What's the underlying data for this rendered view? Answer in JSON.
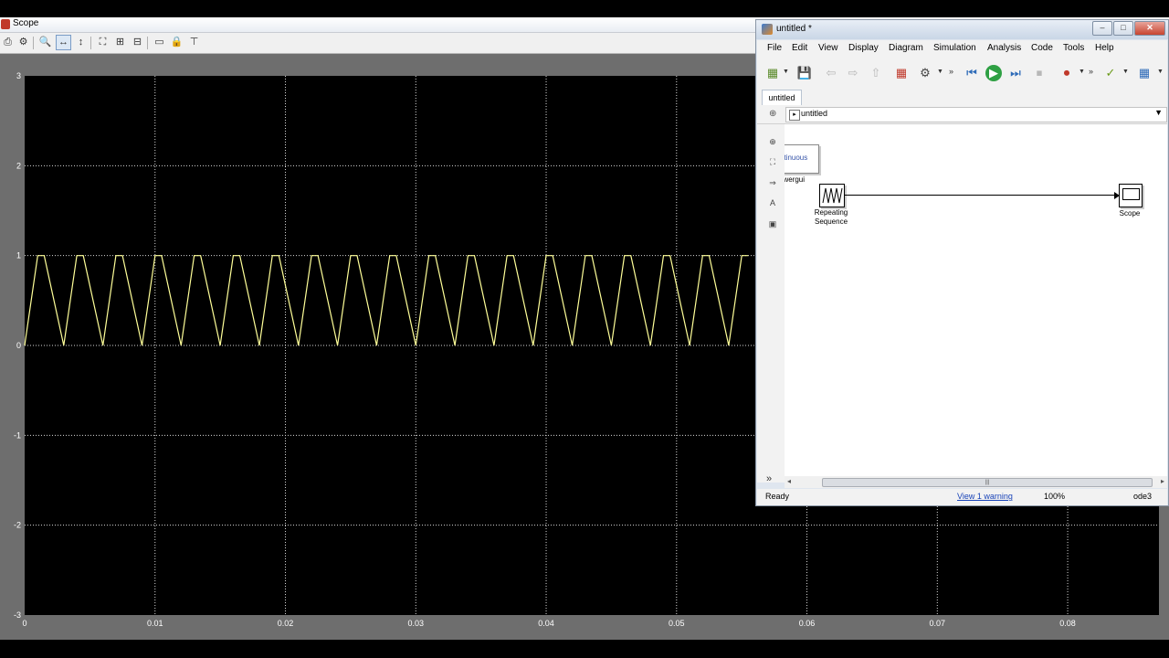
{
  "scope": {
    "title": "Scope",
    "toolbar_icons": [
      "print-icon",
      "parameters-icon",
      "zoom-icon",
      "zoom-x-icon",
      "zoom-y-icon",
      "autoscale-icon",
      "save-axes-icon",
      "restore-axes-icon",
      "floating-scope-icon",
      "lock-icon",
      "signal-selection-icon"
    ]
  },
  "chart_data": {
    "type": "line",
    "series": [
      {
        "x": [
          0,
          0.001,
          0.0015,
          0.003,
          0.004,
          0.0045,
          0.006,
          0.007,
          0.0075,
          0.009,
          0.01,
          0.0105,
          0.012,
          0.013,
          0.0135,
          0.015,
          0.016,
          0.0165,
          0.018,
          0.019,
          0.0195,
          0.021,
          0.022,
          0.0225,
          0.024,
          0.025,
          0.0255,
          0.027,
          0.028,
          0.0285,
          0.03,
          0.031,
          0.0315,
          0.033,
          0.034,
          0.0345,
          0.036,
          0.037,
          0.0375,
          0.039,
          0.04,
          0.0405,
          0.042,
          0.043,
          0.0435,
          0.045,
          0.046,
          0.0465,
          0.048,
          0.049,
          0.0495,
          0.051,
          0.052,
          0.0525,
          0.054,
          0.055,
          0.0555
        ],
        "y": [
          0,
          1,
          1,
          0,
          1,
          1,
          0,
          1,
          1,
          0,
          1,
          1,
          0,
          1,
          1,
          0,
          1,
          1,
          0,
          1,
          1,
          0,
          1,
          1,
          0,
          1,
          1,
          0,
          1,
          1,
          0,
          1,
          1,
          0,
          1,
          1,
          0,
          1,
          1,
          0,
          1,
          1,
          0,
          1,
          1,
          0,
          1,
          1,
          0,
          1,
          1,
          0,
          1,
          1,
          0,
          1,
          1
        ]
      }
    ],
    "xlim": [
      0,
      0.087
    ],
    "ylim": [
      -3,
      3
    ],
    "xticks": [
      "0",
      "0.01",
      "0.02",
      "0.03",
      "0.04",
      "0.05",
      "0.06",
      "0.07",
      "0.08"
    ],
    "yticks": [
      "3",
      "2",
      "1",
      "0",
      "-1",
      "-2",
      "-3"
    ],
    "grid": true,
    "line_color": "#ffff99",
    "background": "#000000"
  },
  "sim": {
    "title": "untitled *",
    "window_buttons": {
      "minimize": "–",
      "maximize": "□",
      "close": "✕"
    },
    "menus": [
      "File",
      "Edit",
      "View",
      "Display",
      "Diagram",
      "Simulation",
      "Analysis",
      "Code",
      "Tools",
      "Help"
    ],
    "toolbar_icons": [
      "new-model-icon",
      "save-icon",
      "back-icon",
      "forward-icon",
      "up-icon",
      "library-browser-icon",
      "model-config-icon",
      "step-back-icon",
      "run-icon",
      "step-forward-icon",
      "stop-icon",
      "record-icon",
      "check-icon",
      "grid-icon"
    ],
    "tab": "untitled",
    "address": "untitled",
    "blocks": {
      "powergui_text": "ntinuous",
      "powergui_label": "owergui",
      "repeating_label_1": "Repeating",
      "repeating_label_2": "Sequence",
      "scope_label": "Scope"
    },
    "status": {
      "ready": "Ready",
      "warning": "View 1 warning",
      "zoom": "100%",
      "solver": "ode3"
    }
  }
}
